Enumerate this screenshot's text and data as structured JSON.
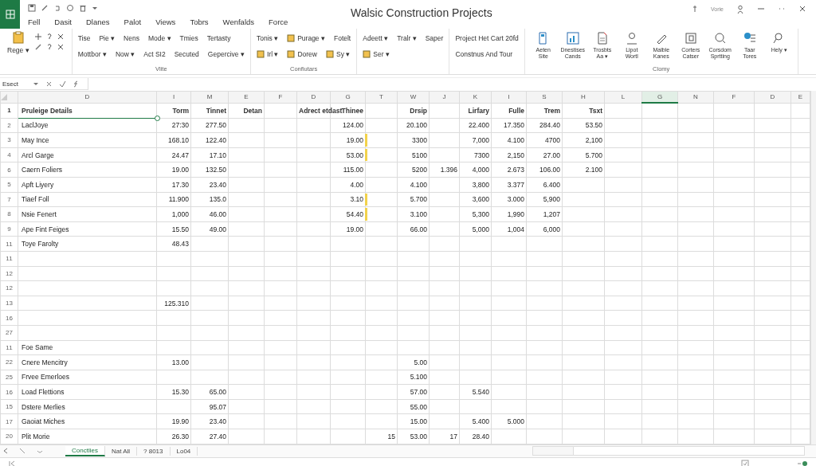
{
  "window": {
    "title": "Walsic Construction Projects",
    "account": "Vorie"
  },
  "menu_tabs": [
    "Fell",
    "Dasit",
    "Dlanes",
    "Palot",
    "Views",
    "Tobrs",
    "Wenfalds",
    "Force"
  ],
  "ribbon": {
    "groups": [
      {
        "kind": "clipboard",
        "top": [
          {
            "label": "Rege ▾",
            "icon": false
          }
        ]
      },
      {
        "kind": "text",
        "label": "Vlite",
        "top": [
          {
            "label": "Tise",
            "icon": false
          },
          {
            "label": "Pie ▾",
            "icon": false
          },
          {
            "label": "Nens",
            "icon": false
          },
          {
            "label": "Mode ▾",
            "icon": false
          },
          {
            "label": "Tmies",
            "icon": false
          },
          {
            "label": "Tertasty",
            "icon": false
          }
        ],
        "bottom": [
          {
            "label": "Mottbor ▾",
            "icon": false
          },
          {
            "label": "Now ▾",
            "icon": false
          },
          {
            "label": "Act SI2",
            "icon": false
          },
          {
            "label": "Secuted",
            "icon": false
          },
          {
            "label": "Gepercive ▾",
            "icon": false
          }
        ]
      },
      {
        "kind": "text",
        "label": "Confiutars",
        "top": [
          {
            "label": "Tonis ▾",
            "icon": false
          },
          {
            "label": "Purage ▾",
            "icon": true
          },
          {
            "label": "Fotelt",
            "icon": false
          }
        ],
        "bottom": [
          {
            "label": "Irl ▾",
            "icon": true
          },
          {
            "label": "Dorew",
            "icon": true
          },
          {
            "label": "Sy ▾",
            "icon": true
          }
        ]
      },
      {
        "kind": "text",
        "top": [
          {
            "label": "Adeett ▾",
            "icon": false
          },
          {
            "label": "Tralr ▾",
            "icon": false
          },
          {
            "label": "Saper",
            "icon": false
          }
        ],
        "bottom": [
          {
            "label": "Ser ▾",
            "icon": true
          }
        ]
      },
      {
        "kind": "text",
        "top": [
          {
            "label": "Project Het Cart 20fd",
            "icon": false
          }
        ],
        "bottom": [
          {
            "label": "Constnus And Tour",
            "icon": false
          }
        ]
      },
      {
        "kind": "large",
        "label": "Clomy",
        "buttons": [
          "Aeten Site",
          "Dnestises Cands",
          "Trosbts Aa ▾",
          "Lipot Wortl",
          "Malble Kanes",
          "Corters Catser",
          "Corsdom Sprtting",
          "Taar Tores",
          "Hely ▾"
        ]
      }
    ]
  },
  "formula_bar": {
    "name_box": "Esect"
  },
  "columns": [
    {
      "letter": "D",
      "selected": false
    },
    {
      "letter": "I",
      "selected": false
    },
    {
      "letter": "M",
      "selected": false
    },
    {
      "letter": "E",
      "selected": false
    },
    {
      "letter": "F",
      "selected": false
    },
    {
      "letter": "D",
      "selected": false
    },
    {
      "letter": "G",
      "selected": false
    },
    {
      "letter": "T",
      "selected": false
    },
    {
      "letter": "W",
      "selected": false
    },
    {
      "letter": "J",
      "selected": false
    },
    {
      "letter": "K",
      "selected": false
    },
    {
      "letter": "I",
      "selected": false
    },
    {
      "letter": "S",
      "selected": false
    },
    {
      "letter": "H",
      "selected": false
    },
    {
      "letter": "L",
      "selected": false
    },
    {
      "letter": "G",
      "selected": true
    },
    {
      "letter": "N",
      "selected": false
    },
    {
      "letter": "F",
      "selected": false
    },
    {
      "letter": "D",
      "selected": false
    },
    {
      "letter": "E",
      "selected": false
    }
  ],
  "rows": [
    {
      "header": "1",
      "selected": true,
      "marked": false,
      "cells": [
        "Pruleige Details",
        "Torm",
        "Tinnet",
        "Detan",
        null,
        "Adrect etdast",
        "Thinee",
        null,
        "Drsip",
        null,
        "Lirfary",
        "Fulle",
        "Trem",
        "Tsxt"
      ]
    },
    {
      "header": "2",
      "selected": false,
      "marked": false,
      "cells": [
        "LaclJoye",
        "27:30",
        "277.50",
        null,
        null,
        null,
        "124.00",
        null,
        "20.100",
        null,
        "22.400",
        "17.350",
        "284.40",
        "53.50"
      ]
    },
    {
      "header": "3",
      "selected": false,
      "marked": true,
      "cells": [
        "May Ince",
        "168.10",
        "122.40",
        null,
        null,
        null,
        "19.00",
        null,
        "3300",
        null,
        "7,000",
        "4.100",
        "4700",
        "2,100"
      ]
    },
    {
      "header": "4",
      "selected": false,
      "marked": true,
      "cells": [
        "Arcl Garge",
        "24.47",
        "17.10",
        null,
        null,
        null,
        "53.00",
        null,
        "5100",
        null,
        "7300",
        "2,150",
        "27.00",
        "5.700"
      ]
    },
    {
      "header": "6",
      "selected": false,
      "marked": false,
      "cells": [
        "Caern Foliers",
        "19.00",
        "132.50",
        null,
        null,
        null,
        "115.00",
        null,
        "5200",
        "1.396",
        "4,000",
        "2.673",
        "106.00",
        "2.100"
      ]
    },
    {
      "header": "5",
      "selected": false,
      "marked": false,
      "cells": [
        "Apft Liyery",
        "17.30",
        "23.40",
        null,
        null,
        null,
        "4.00",
        null,
        "4.100",
        null,
        "3,800",
        "3.377",
        "6.400"
      ]
    },
    {
      "header": "7",
      "selected": false,
      "marked": true,
      "cells": [
        "Tiaef Foll",
        "11.900",
        "135.0",
        null,
        null,
        null,
        "3.10",
        null,
        "5.700",
        null,
        "3,600",
        "3.000",
        "5,900"
      ]
    },
    {
      "header": "8",
      "selected": false,
      "marked": true,
      "cells": [
        "Nsie Fenert",
        "1,000",
        "46.00",
        null,
        null,
        null,
        "54.40",
        null,
        "3.100",
        null,
        "5,300",
        "1,990",
        "1,207"
      ]
    },
    {
      "header": "9",
      "selected": false,
      "marked": false,
      "cells": [
        "Ape Fint Feiges",
        "15.50",
        "49.00",
        null,
        null,
        null,
        "19.00",
        null,
        "66.00",
        null,
        "5,000",
        "1,004",
        "6,000"
      ]
    },
    {
      "header": "11",
      "selected": false,
      "marked": false,
      "cells": [
        "Toye Farolty",
        "48.43"
      ]
    },
    {
      "header": "11",
      "selected": false,
      "marked": false,
      "cells": []
    },
    {
      "header": "12",
      "selected": false,
      "marked": false,
      "cells": []
    },
    {
      "header": "12",
      "selected": false,
      "marked": false,
      "cells": []
    },
    {
      "header": "13",
      "selected": false,
      "marked": false,
      "cells": [
        null,
        "125.310"
      ]
    },
    {
      "header": "16",
      "selected": false,
      "marked": false,
      "cells": []
    },
    {
      "header": "27",
      "selected": false,
      "marked": false,
      "cells": []
    },
    {
      "header": "11",
      "selected": false,
      "marked": false,
      "cells": [
        "Foe Same"
      ]
    },
    {
      "header": "22",
      "selected": false,
      "marked": false,
      "cells": [
        "Cnere Mencitry",
        "13.00",
        null,
        null,
        null,
        null,
        null,
        null,
        "5.00"
      ]
    },
    {
      "header": "25",
      "selected": false,
      "marked": false,
      "cells": [
        "Frvee Emerloes",
        null,
        null,
        null,
        null,
        null,
        null,
        null,
        "5.100"
      ]
    },
    {
      "header": "16",
      "selected": false,
      "marked": false,
      "cells": [
        "Load Flettions",
        "15.30",
        "65.00",
        null,
        null,
        null,
        null,
        null,
        "57.00",
        null,
        "5.540"
      ]
    },
    {
      "header": "15",
      "selected": false,
      "marked": false,
      "cells": [
        "Dstere Merlies",
        null,
        "95.07",
        null,
        null,
        null,
        null,
        null,
        "55.00"
      ]
    },
    {
      "header": "17",
      "selected": false,
      "marked": false,
      "cells": [
        "Gaoiat Miches",
        "19.90",
        "23.40",
        null,
        null,
        null,
        null,
        null,
        "15.00",
        null,
        "5.400",
        "5.000"
      ]
    },
    {
      "header": "20",
      "selected": false,
      "marked": false,
      "cells": [
        "Plit Morie",
        "26.30",
        "27.40",
        null,
        null,
        null,
        null,
        "15",
        "53.00",
        "17",
        "28.40"
      ]
    }
  ],
  "sheet_tabs": [
    {
      "label": "Conctlies",
      "selected": true
    },
    {
      "label": "Nat All",
      "selected": false
    },
    {
      "label": "? 8013",
      "selected": false
    },
    {
      "label": "Lo04",
      "selected": false
    }
  ]
}
